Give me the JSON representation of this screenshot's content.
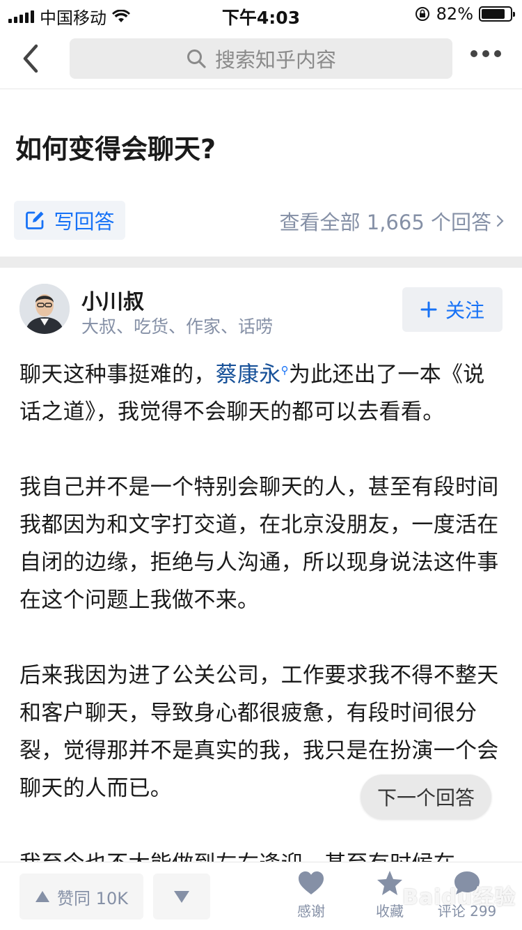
{
  "status_bar": {
    "carrier": "中国移动",
    "time": "下午4:03",
    "battery_percent": "82%",
    "battery_level": 0.82
  },
  "nav": {
    "search_placeholder": "搜索知乎内容"
  },
  "question": {
    "title": "如何变得会聊天?",
    "write_answer_label": "写回答",
    "view_all_label": "查看全部 1,665 个回答"
  },
  "author": {
    "name": "小川叔",
    "bio": "大叔、吃货、作家、话唠",
    "follow_label": "关注"
  },
  "answer": {
    "p1_before": "聊天这种事挺难的，",
    "p1_link": "蔡康永",
    "p1_after": "为此还出了一本《说话之道》，我觉得不会聊天的都可以去看看。",
    "p2": "我自己并不是一个特别会聊天的人，甚至有段时间我都因为和文字打交道，在北京没朋友，一度活在自闭的边缘，拒绝与人沟通，所以现身说法这件事在这个问题上我做不来。",
    "p3": "后来我因为进了公关公司，工作要求我不得不整天和客户聊天，导致身心都很疲惫，有段时间很分裂，觉得那并不是真实的我，我只是在扮演一个会聊天的人而已。",
    "p4": "我至今也不太能做到左右逢迎，甚至有时候在"
  },
  "next_answer_label": "下一个回答",
  "bottom_bar": {
    "vote_up_label": "赞同 10K",
    "thanks_label": "感谢",
    "collect_label": "收藏",
    "comment_label": "评论 299"
  },
  "watermark": "Baidu经验",
  "colors": {
    "accent": "#1772f6",
    "link": "#175199",
    "muted": "#8590a6"
  }
}
